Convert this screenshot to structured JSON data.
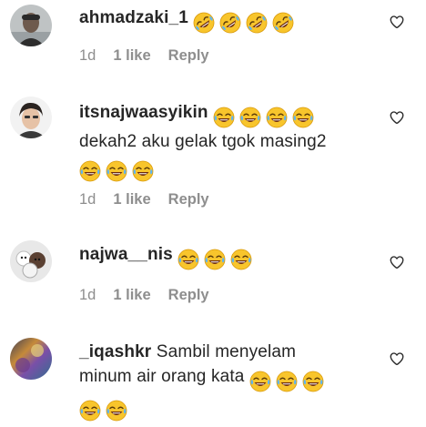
{
  "comments": [
    {
      "username": "ahmadzaki_1",
      "text": "",
      "emoji_laughing_rolling_count": 4,
      "time": "1d",
      "likes": "1 like",
      "reply": "Reply"
    },
    {
      "username": "itsnajwaasyikin",
      "text": "dekah2 aku gelak tgok masing2",
      "emoji_laughing_count_line1": 4,
      "emoji_laughing_count_line3": 3,
      "time": "1d",
      "likes": "1 like",
      "reply": "Reply"
    },
    {
      "username": "najwa__nis",
      "text": "",
      "emoji_laughing_count": 3,
      "time": "1d",
      "likes": "1 like",
      "reply": "Reply"
    },
    {
      "username": "_iqashkr",
      "text_line1": "Sambil menyelam",
      "text_line2": "minum air orang kata",
      "emoji_laughing_count_line2": 3,
      "emoji_laughing_count_line3": 2
    }
  ],
  "icons": {
    "emoji_rolling": "rolling-on-floor-laughing-emoji",
    "emoji_tears": "face-with-tears-of-joy-emoji",
    "heart": "heart-outline-icon"
  },
  "colors": {
    "text": "#262626",
    "meta": "#8e8e8e",
    "emoji_face": "#f8c52c"
  }
}
